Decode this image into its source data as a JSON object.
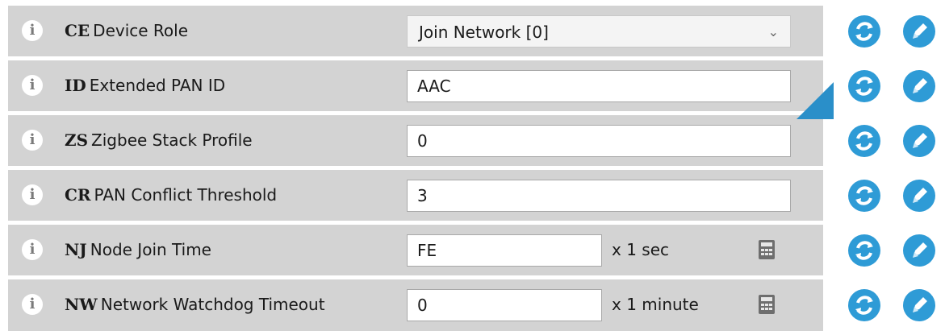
{
  "rows": [
    {
      "code": "CE",
      "label": "Device Role",
      "control": "select",
      "value": "Join Network [0]",
      "icons": [
        "info-icon",
        "chevron-down-icon",
        "refresh-icon",
        "edit-icon"
      ]
    },
    {
      "code": "ID",
      "label": "Extended PAN ID",
      "control": "input",
      "value": "AAC",
      "modified": true,
      "icons": [
        "info-icon",
        "refresh-icon",
        "edit-icon"
      ]
    },
    {
      "code": "ZS",
      "label": "Zigbee Stack Profile",
      "control": "input",
      "value": "0",
      "icons": [
        "info-icon",
        "refresh-icon",
        "edit-icon"
      ]
    },
    {
      "code": "CR",
      "label": "PAN Conflict Threshold",
      "control": "input",
      "value": "3",
      "icons": [
        "info-icon",
        "refresh-icon",
        "edit-icon"
      ]
    },
    {
      "code": "NJ",
      "label": "Node Join Time",
      "control": "input-unit",
      "value": "FE",
      "unit": "x 1 sec",
      "icons": [
        "info-icon",
        "calculator-icon",
        "refresh-icon",
        "edit-icon"
      ]
    },
    {
      "code": "NW",
      "label": "Network Watchdog Timeout",
      "control": "input-unit",
      "value": "0",
      "unit": "x 1 minute",
      "icons": [
        "info-icon",
        "calculator-icon",
        "refresh-icon",
        "edit-icon"
      ]
    }
  ],
  "info_glyph": "i",
  "chevron_glyph": "⌄",
  "colors": {
    "row_bg": "#d3d3d3",
    "accent_blue": "#2e9bd6",
    "modified_marker": "#2a8fc9",
    "info_fg": "#7a7a7a"
  }
}
